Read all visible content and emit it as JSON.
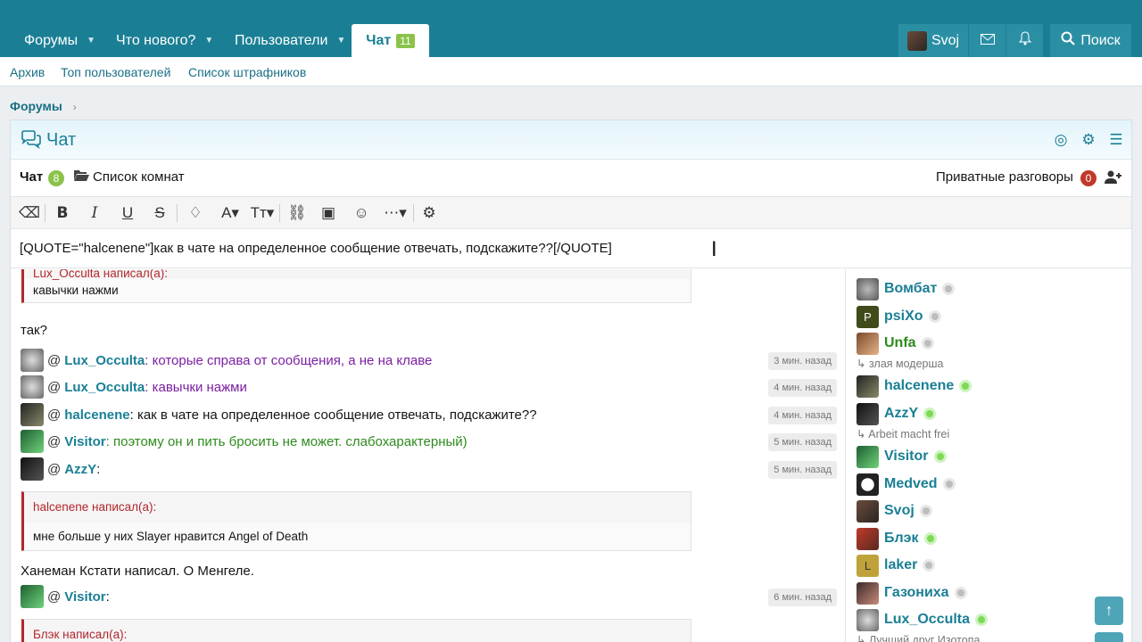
{
  "nav": {
    "tabs": [
      {
        "label": "Форумы"
      },
      {
        "label": "Что нового?"
      },
      {
        "label": "Пользователи"
      },
      {
        "label": "Чат",
        "badge": "11"
      }
    ],
    "user": "Svoj",
    "search": "Поиск"
  },
  "subnav": [
    "Архив",
    "Топ пользователей",
    "Список штрафников"
  ],
  "breadcrumb": "Форумы",
  "panel": {
    "title": "Чат",
    "room_label": "Чат",
    "room_count": "8",
    "rooms_list": "Список комнат",
    "private": "Приватные разговоры",
    "private_count": "0"
  },
  "editor": {
    "text": "[QUOTE=\"halcenene\"]как в чате на определенное сообщение отвечать, подскажите??[/QUOTE]"
  },
  "messages": {
    "quote1": {
      "header": "Lux_Occulta написал(а):",
      "body": "кавычки нажми"
    },
    "text1": "так?",
    "rows": [
      {
        "user": "Lux_Occulta",
        "text": ": которые справа от сообщения, а не на клаве",
        "color": "#7b1fa2",
        "time": "3 мин. назад"
      },
      {
        "user": "Lux_Occulta",
        "text": ": кавычки нажми",
        "color": "#7b1fa2",
        "time": "4 мин. назад"
      },
      {
        "user": "halcenene",
        "text": ": как в чате на определенное сообщение отвечать, подскажите??",
        "color": "#141414",
        "time": "4 мин. назад"
      },
      {
        "user": "Visitor",
        "text": ": поэтому он и пить бросить не может. слабохарактерный)",
        "color": "#2e8b1e",
        "time": "5 мин. назад"
      },
      {
        "user": "AzzY",
        "text": ":",
        "color": "#141414",
        "time": "5 мин. назад"
      }
    ],
    "quote2": {
      "header": "halcenene написал(а):",
      "body": "мне больше у них Slayer нравится Angel of Death"
    },
    "text2": "Ханеман Кстати написал. О Менгеле.",
    "row6": {
      "user": "Visitor",
      "text": ":",
      "time": "6 мин. назад"
    },
    "quote3": {
      "header": "Блэк написал(а):"
    }
  },
  "users": [
    {
      "name": "Вомбат",
      "online": false,
      "color": "#1a7f95"
    },
    {
      "name": "psiXo",
      "online": false,
      "color": "#1a7f95",
      "letter": "P"
    },
    {
      "name": "Unfa",
      "online": false,
      "color": "#2e8b1e",
      "status": "↳ злая модерша"
    },
    {
      "name": "halcenene",
      "online": true,
      "color": "#1a7f95"
    },
    {
      "name": "AzzY",
      "online": true,
      "color": "#1a7f95",
      "status": "↳ Arbeit macht frei"
    },
    {
      "name": "Visitor",
      "online": true,
      "color": "#1a7f95"
    },
    {
      "name": "Medved",
      "online": false,
      "color": "#1a7f95"
    },
    {
      "name": "Svoj",
      "online": false,
      "color": "#1a7f95"
    },
    {
      "name": "Блэк",
      "online": true,
      "color": "#1a7f95"
    },
    {
      "name": "laker",
      "online": false,
      "color": "#1a7f95",
      "letter": "L"
    },
    {
      "name": "Газониха",
      "online": false,
      "color": "#1a7f95"
    },
    {
      "name": "Lux_Occulta",
      "online": true,
      "color": "#1a7f95",
      "status": "↳ Лучший друг Изотопа"
    }
  ]
}
